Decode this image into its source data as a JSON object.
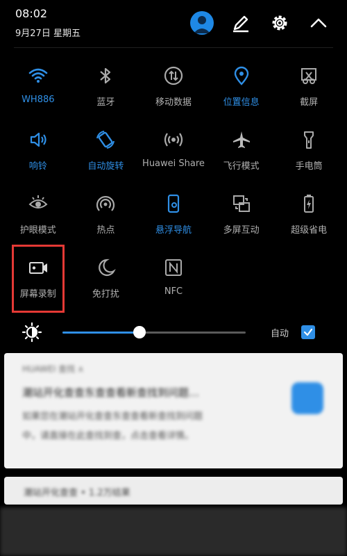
{
  "status": {
    "time": "08:02",
    "date": "9月27日 星期五"
  },
  "top_actions": [
    "avatar",
    "edit-icon",
    "gear-icon",
    "chevron-up-icon"
  ],
  "tiles": [
    {
      "label": "WH886",
      "icon": "wifi-icon",
      "active": true
    },
    {
      "label": "蓝牙",
      "icon": "bluetooth-icon",
      "active": false
    },
    {
      "label": "移动数据",
      "icon": "mobile-data-icon",
      "active": false
    },
    {
      "label": "位置信息",
      "icon": "location-icon",
      "active": true
    },
    {
      "label": "截屏",
      "icon": "screenshot-icon",
      "active": false
    },
    {
      "label": "响铃",
      "icon": "ring-icon",
      "active": true
    },
    {
      "label": "自动旋转",
      "icon": "rotate-icon",
      "active": true
    },
    {
      "label": "Huawei Share",
      "icon": "share-icon",
      "active": false
    },
    {
      "label": "飞行模式",
      "icon": "airplane-icon",
      "active": false
    },
    {
      "label": "手电筒",
      "icon": "flashlight-icon",
      "active": false
    },
    {
      "label": "护眼模式",
      "icon": "eye-icon",
      "active": false
    },
    {
      "label": "热点",
      "icon": "hotspot-icon",
      "active": false
    },
    {
      "label": "悬浮导航",
      "icon": "float-nav-icon",
      "active": true
    },
    {
      "label": "多屏互动",
      "icon": "multiscreen-icon",
      "active": false
    },
    {
      "label": "超级省电",
      "icon": "battery-icon",
      "active": false
    },
    {
      "label": "屏幕录制",
      "icon": "screen-record-icon",
      "active": false
    },
    {
      "label": "免打扰",
      "icon": "moon-icon",
      "active": false
    },
    {
      "label": "NFC",
      "icon": "nfc-icon",
      "active": false
    }
  ],
  "brightness": {
    "level": 0.42,
    "auto_label": "自动",
    "auto_checked": true
  },
  "notification": {
    "app": "HUAWEI 查找 ∧",
    "title": "潮站开化查查东查查看新查找到问题…",
    "body1": "如果您在潮站开化查查东查查看新查找到问题",
    "body2": "中，请直接在此查找到查，点击查看详情。"
  },
  "search": {
    "text": "潮站开化查查 • 1.2万结果"
  },
  "colors": {
    "accent": "#2f8fe6",
    "highlight": "#e53935"
  }
}
